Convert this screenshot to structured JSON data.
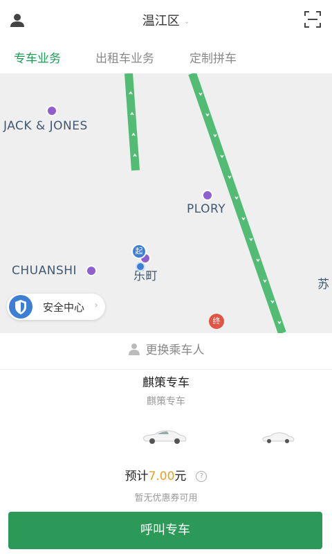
{
  "header": {
    "district": "温江区"
  },
  "tabs": [
    {
      "label": "专车业务",
      "active": true
    },
    {
      "label": "出租车业务",
      "active": false
    },
    {
      "label": "定制拼车",
      "active": false
    }
  ],
  "map": {
    "pois": [
      "JACK & JONES",
      "PLORY",
      "CHUANSHI",
      "乐町",
      "苏"
    ],
    "start_marker": "起",
    "end_marker": "终",
    "route_color": "#52bb74",
    "safety_center": "安全中心"
  },
  "panel": {
    "change_passenger": "更换乘车人",
    "car_title": "麒策专车",
    "car_subtitle": "麒策专车",
    "price_prefix": "预计",
    "price_value": "7.00",
    "price_unit": "元",
    "coupon_text": "暂无优惠券可用",
    "call_button": "呼叫专车"
  },
  "colors": {
    "accent": "#1e9a56",
    "button": "#2b9a59",
    "price": "#e5a12a",
    "poi": "#8f5fd0"
  }
}
